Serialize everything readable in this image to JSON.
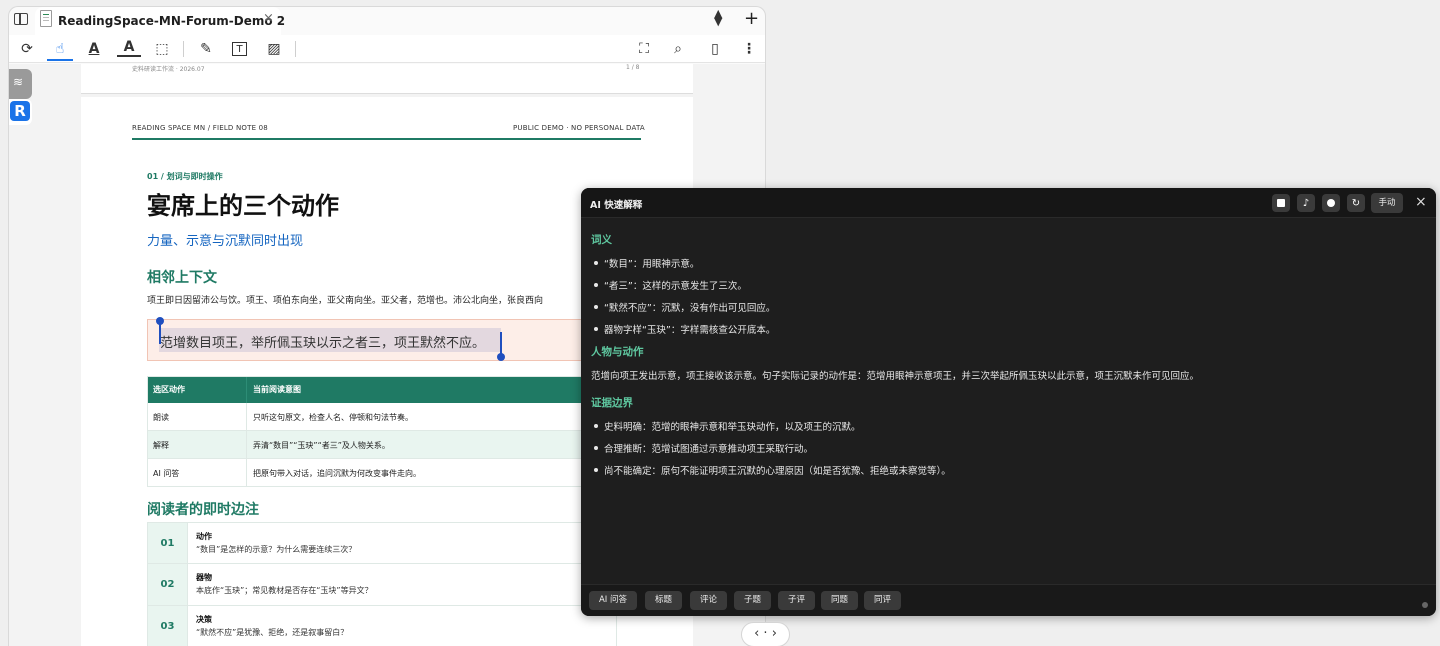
{
  "window": {
    "tab_title": "ReadingSpace-MN-Forum-Demo 2",
    "close_glyph": "×",
    "sort_glyph": "▲▼",
    "add_glyph": "+"
  },
  "toolbar": {
    "icons": [
      "sync-icon",
      "pointer-icon",
      "text-underline-icon",
      "text-color-icon",
      "lasso-select-icon",
      "pen-icon",
      "textbox-icon",
      "image-icon",
      "fullscreen-icon",
      "search-document-icon",
      "bookmark-icon",
      "more-icon"
    ],
    "glyphs": {
      "sync": "⟳",
      "pointer": "☝",
      "underline": "A",
      "textcolor": "A",
      "lasso": "⬚",
      "pen": "✎",
      "textbox": "T",
      "image": "▨",
      "fullscreen": "⛶",
      "search": "⌕",
      "bookmark": "▯",
      "more": "⋮"
    },
    "active_color": "#1a73e8"
  },
  "sidebar": {
    "layers_glyph": "≋",
    "logo_letter": "R"
  },
  "document": {
    "prev_page": {
      "footer_left": "史料研读工作流 · 2026.07",
      "footer_right": "1 / 8"
    },
    "header_left": "READING SPACE MN / FIELD NOTE 08",
    "header_right": "PUBLIC DEMO · NO PERSONAL DATA",
    "section_tag": "01 / 划词与即时操作",
    "title": "宴席上的三个动作",
    "subtitle": "力量、示意与沉默同时出现",
    "context_heading": "相邻上下文",
    "context_text": "项王即日因留沛公与饮。项王、项伯东向坐，亚父南向坐。亚父者，范增也。沛公北向坐，张良西向",
    "quote": "范增数目项王，举所佩玉玦以示之者三，项王默然不应。",
    "table": {
      "headers": [
        "选区动作",
        "当前阅读意图"
      ],
      "rows": [
        [
          "朗读",
          "只听这句原文，检查人名、停顿和句法节奏。"
        ],
        [
          "解释",
          "弄清“数目”“玉玦”“者三”及人物关系。"
        ],
        [
          "AI 问答",
          "把原句带入对话，追问沉默为何改变事件走向。"
        ]
      ]
    },
    "notes_heading": "阅读者的即时边注",
    "notes": [
      {
        "num": "01",
        "title": "动作",
        "text": "“数目”是怎样的示意？为什么需要连续三次？"
      },
      {
        "num": "02",
        "title": "器物",
        "text": "本底作“玉玦”；常见教材是否存在“玉块”等异文？"
      },
      {
        "num": "03",
        "title": "决策",
        "text": "“默然不应”是犹豫、拒绝，还是叙事留白？"
      }
    ],
    "accent": "#1f7a64",
    "highlight_bg": "#fdeee8"
  },
  "ai_panel": {
    "title": "AI 快速解释",
    "mode_label": "手动",
    "controls": [
      "stop-icon",
      "music-note-icon",
      "record-icon",
      "refresh-icon"
    ],
    "note_glyph": "♪",
    "refresh_glyph": "↻",
    "close_glyph": "×",
    "sections": {
      "meaning": {
        "heading": "词义",
        "items": [
          "“数目”：用眼神示意。",
          "“者三”：这样的示意发生了三次。",
          "“默然不应”：沉默，没有作出可见回应。",
          "器物字样“玉玦”：字样需核查公开底本。"
        ]
      },
      "people": {
        "heading": "人物与动作",
        "text": "范增向项王发出示意，项王接收该示意。句子实际记录的动作是：范增用眼神示意项王，并三次举起所佩玉玦以此示意，项王沉默未作可见回应。"
      },
      "evidence": {
        "heading": "证据边界",
        "items": [
          "史料明确：范增的眼神示意和举玉玦动作，以及项王的沉默。",
          "合理推断：范增试图通过示意推动项王采取行动。",
          "尚不能确定：原句不能证明项王沉默的心理原因（如是否犹豫、拒绝或未察觉等）。"
        ]
      }
    },
    "footer_buttons": [
      "AI 问答",
      "标题",
      "评论",
      "子题",
      "子评",
      "同题",
      "同评"
    ],
    "heading_color": "#5fc8a0",
    "background": "#1e1e1e"
  },
  "page_nav": {
    "label": "‹ · ›"
  }
}
